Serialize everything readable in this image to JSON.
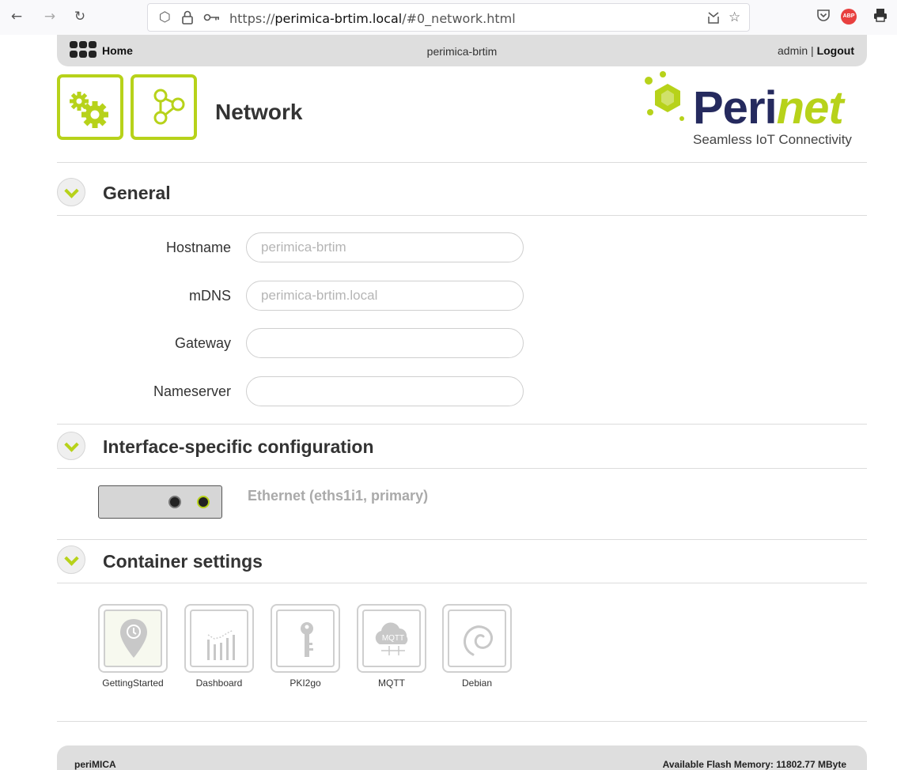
{
  "browser": {
    "url_prefix": "https://",
    "url_host": "perimica-brtim.local",
    "url_path": "/#0_network.html",
    "adblock_label": "ABP"
  },
  "topbar": {
    "home_label": "Home",
    "hostname": "perimica-brtim",
    "user": "admin",
    "separator": "|",
    "logout_label": "Logout"
  },
  "header": {
    "title": "Network",
    "logo_text_main": "Peri",
    "logo_text_accent": "net",
    "logo_tagline": "Seamless IoT Connectivity"
  },
  "sections": {
    "general": "General",
    "interface": "Interface-specific configuration",
    "containers": "Container settings"
  },
  "form": {
    "hostname": {
      "label": "Hostname",
      "placeholder": "perimica-brtim",
      "value": ""
    },
    "mdns": {
      "label": "mDNS",
      "placeholder": "perimica-brtim.local",
      "value": ""
    },
    "gateway": {
      "label": "Gateway",
      "placeholder": "",
      "value": ""
    },
    "nameserver": {
      "label": "Nameserver",
      "placeholder": "",
      "value": ""
    }
  },
  "interfaces": [
    {
      "label": "Ethernet (eths1i1, primary)"
    }
  ],
  "containers": [
    {
      "label": "GettingStarted",
      "icon": "location-pin-icon"
    },
    {
      "label": "Dashboard",
      "icon": "chart-bars-icon"
    },
    {
      "label": "PKI2go",
      "icon": "key-icon"
    },
    {
      "label": "MQTT",
      "icon": "mqtt-cloud-icon",
      "icon_text": "MQTT"
    },
    {
      "label": "Debian",
      "icon": "debian-swirl-icon"
    }
  ],
  "footer": {
    "product": "periMICA",
    "memory": "Available Flash Memory: 11802.77 MByte"
  },
  "colors": {
    "accent": "#b7d21a",
    "brand_navy": "#252a5e",
    "bar_gray": "#dedede"
  }
}
